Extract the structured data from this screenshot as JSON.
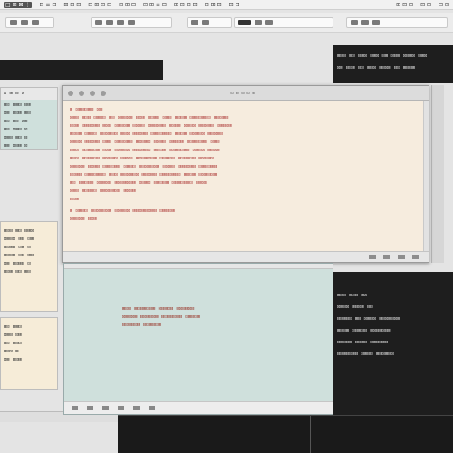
{
  "menubar": {
    "items": [
      "□ ⊞ ⊠ ⋮",
      "⊡ ≡ ⊟",
      "⊞ ⊡ ⊡",
      "⊟ ⊞ ⊡ ⊟",
      "⊡ ⊞ ⊟",
      "⊡ ⊞ ≡ ⊟",
      "⊞ ⊡ ⊟ ⊡",
      "⊟ ⊞ ⊡",
      "⊡ ⊟"
    ],
    "right_items": [
      "⊞ ⊡ ⊟",
      "⊡ ⊞",
      "⊟ ⊡"
    ]
  },
  "toolbar": {
    "groups": [
      "⊞ ⊡ ⊟ ⊡",
      "⊟ ⊞ ⊡ ⊟",
      "⊞ ⊡ ⊞",
      "⊡ ⊟ ⊞ ⊡"
    ]
  },
  "left_panes": {
    "top": {
      "title": "⊡ ⊞ ⊟ ⊡",
      "lines": [
        "⊞⊡ ⊟⊞⊡ ⊟⊞",
        "⊡⊞ ⊟⊡⊞ ⊞⊟",
        "⊟⊡ ⊞⊟ ⊡⊞",
        "⊞⊟ ⊡⊞⊟ ⊡",
        "⊡⊞⊟ ⊞⊡ ⊟",
        "⊟⊞ ⊡⊟⊞ ⊡"
      ]
    },
    "middle": {
      "lines": [
        "⊞⊡⊟ ⊞⊡ ⊟⊞⊡",
        "⊡⊞⊟⊡ ⊞⊟ ⊡⊞",
        "⊟⊡⊞⊟ ⊡⊞ ⊟",
        "⊞⊟⊡⊞ ⊟⊡ ⊞⊟",
        "⊡⊞ ⊟⊡⊞⊟ ⊡",
        "⊟⊡⊞ ⊟⊡ ⊞⊟"
      ]
    },
    "bottom": {
      "lines": [
        "⊞⊡ ⊟⊞⊡",
        "⊡⊞⊟ ⊡⊞",
        "⊟⊡ ⊞⊟⊡",
        "⊞⊟⊡ ⊞",
        "⊡⊞ ⊟⊡⊞"
      ]
    }
  },
  "editor": {
    "window_title": "⊡ ⊞ ⊟ ⊡ ⊞",
    "lines": [
      "⊞ ⊡⊞⊟⊡⊞⊟ ⊡⊞",
      "⊡⊞⊟ ⊞⊡⊟ ⊡⊞⊟⊡ ⊞⊟ ⊡⊞⊟⊡⊞ ⊟⊡⊞ ⊟⊡⊞⊟ ⊡⊞⊟ ⊞⊡⊟⊞ ⊡⊞⊟⊡⊞⊟⊡ ⊞⊟⊡⊞⊟",
      "⊟⊡⊞ ⊡⊞⊟⊡⊞⊟ ⊞⊡⊟ ⊡⊞⊟⊡⊞ ⊟⊡⊞⊟ ⊡⊞⊟⊡⊞⊟ ⊞⊡⊟⊞ ⊡⊞⊟⊡ ⊞⊟⊡⊞⊟ ⊡⊞⊟⊡⊞",
      "⊞⊡⊟⊞ ⊡⊞⊟⊡ ⊞⊟⊡⊞⊟⊡ ⊞⊟⊡ ⊞⊟⊡⊞⊟ ⊡⊞⊟⊡⊞⊟⊡ ⊞⊟⊡⊞ ⊟⊡⊞⊟⊡ ⊞⊟⊡⊞⊟",
      "⊡⊞⊟⊡ ⊞⊟⊡⊞⊟ ⊡⊞⊟ ⊡⊞⊟⊡⊞⊟ ⊞⊡⊟⊞⊡ ⊟⊡⊞⊟ ⊡⊞⊟⊡⊞ ⊟⊡⊞⊟⊡⊞⊟ ⊡⊞⊟",
      "⊟⊞⊡ ⊟⊡⊞⊟⊡⊞ ⊟⊡⊞ ⊟⊡⊞⊟⊡ ⊞⊟⊡⊞⊟⊡ ⊞⊟⊡⊞ ⊟⊡⊞⊟⊡⊞⊟ ⊡⊞⊟⊡ ⊞⊟⊡⊞",
      "⊞⊟⊡ ⊞⊡⊟⊞⊡⊟ ⊞⊡⊟⊞⊡ ⊟⊞⊡⊟ ⊞⊡⊟⊞⊡⊟⊞ ⊡⊟⊞⊡⊟ ⊞⊡⊟⊞⊡⊟ ⊞⊡⊟⊞⊡",
      "⊡⊞⊟⊡⊞ ⊟⊡⊞⊟ ⊡⊞⊟⊡⊞⊟ ⊡⊞⊟⊡ ⊞⊟⊡⊞⊟⊡⊞ ⊟⊡⊞⊟ ⊡⊞⊟⊡⊞⊟ ⊡⊞⊟⊡⊞⊟",
      "⊟⊡⊞⊟ ⊡⊞⊟⊡⊞⊟⊡ ⊞⊟⊡ ⊞⊟⊡⊞⊟⊡ ⊞⊟⊡⊞⊟ ⊡⊞⊟⊡⊞⊟⊡ ⊞⊟⊡⊞ ⊟⊡⊞⊟⊡⊞",
      "⊞⊡ ⊟⊞⊡⊟⊞ ⊡⊟⊞⊡⊟ ⊞⊡⊟⊞⊡⊟⊞ ⊡⊟⊞⊡ ⊟⊞⊡⊟⊞ ⊡⊟⊞⊡⊟⊞⊡ ⊟⊞⊡⊟",
      "⊡⊞⊟ ⊞⊡⊟⊞⊡ ⊟⊞⊡⊟⊞⊡⊟ ⊞⊡⊟⊞",
      "⊟⊡⊞",
      "⊞ ⊡⊞⊟⊡ ⊞⊟⊡⊞⊟⊡⊞ ⊟⊡⊞⊟⊡ ⊞⊟⊡⊞⊟⊡⊞⊟ ⊡⊞⊟⊡⊞",
      "⊡⊞⊟⊡⊞ ⊟⊡⊞"
    ]
  },
  "doc": {
    "lines": [
      "⊞⊡⊟ ⊞⊡⊟⊞⊡⊟⊞ ⊡⊟⊞⊡⊟ ⊞⊡⊟⊞⊡⊟",
      "⊡⊞⊟⊡⊞ ⊟⊡⊞⊟⊡⊞ ⊟⊡⊞⊟⊡⊞⊟ ⊡⊞⊟⊡⊞",
      "⊟⊡⊞⊟⊡⊞ ⊟⊡⊞⊟⊡⊞"
    ]
  },
  "terminal_top": {
    "lines": [
      "⊞⊡⊟ ⊞⊡ ⊟⊞⊡ ⊟⊞⊡ ⊟⊞ ⊡⊟⊞ ⊡⊟⊞⊡ ⊟⊞⊡",
      "⊡⊞ ⊟⊡⊞ ⊟⊡ ⊞⊟⊡ ⊞⊟⊡⊞ ⊟⊡ ⊞⊟⊡⊞"
    ]
  },
  "terminal_bottom": {
    "lines": [
      "⊞⊡⊟ ⊞⊡⊟ ⊞⊡",
      "⊡⊞⊟⊡ ⊞⊟⊡⊞ ⊟⊡",
      "⊟⊡⊞⊟⊡ ⊞⊟ ⊡⊞⊟⊡ ⊞⊟⊡⊞⊟⊡⊞",
      "⊞⊡⊟⊞ ⊡⊟⊞⊡⊟ ⊞⊡⊟⊞⊡⊟⊞",
      "⊡⊞⊟⊡⊞ ⊟⊡⊞⊟ ⊡⊞⊟⊡⊞⊟",
      "⊟⊡⊞⊟⊡⊞⊟ ⊡⊞⊟⊡ ⊞⊟⊡⊞⊟⊡"
    ]
  },
  "colors": {
    "editor_bg": "#f6ecde",
    "doc_bg": "#cfe0dc",
    "code_text": "#b0413e",
    "terminal_bg": "#1e1e1e"
  }
}
